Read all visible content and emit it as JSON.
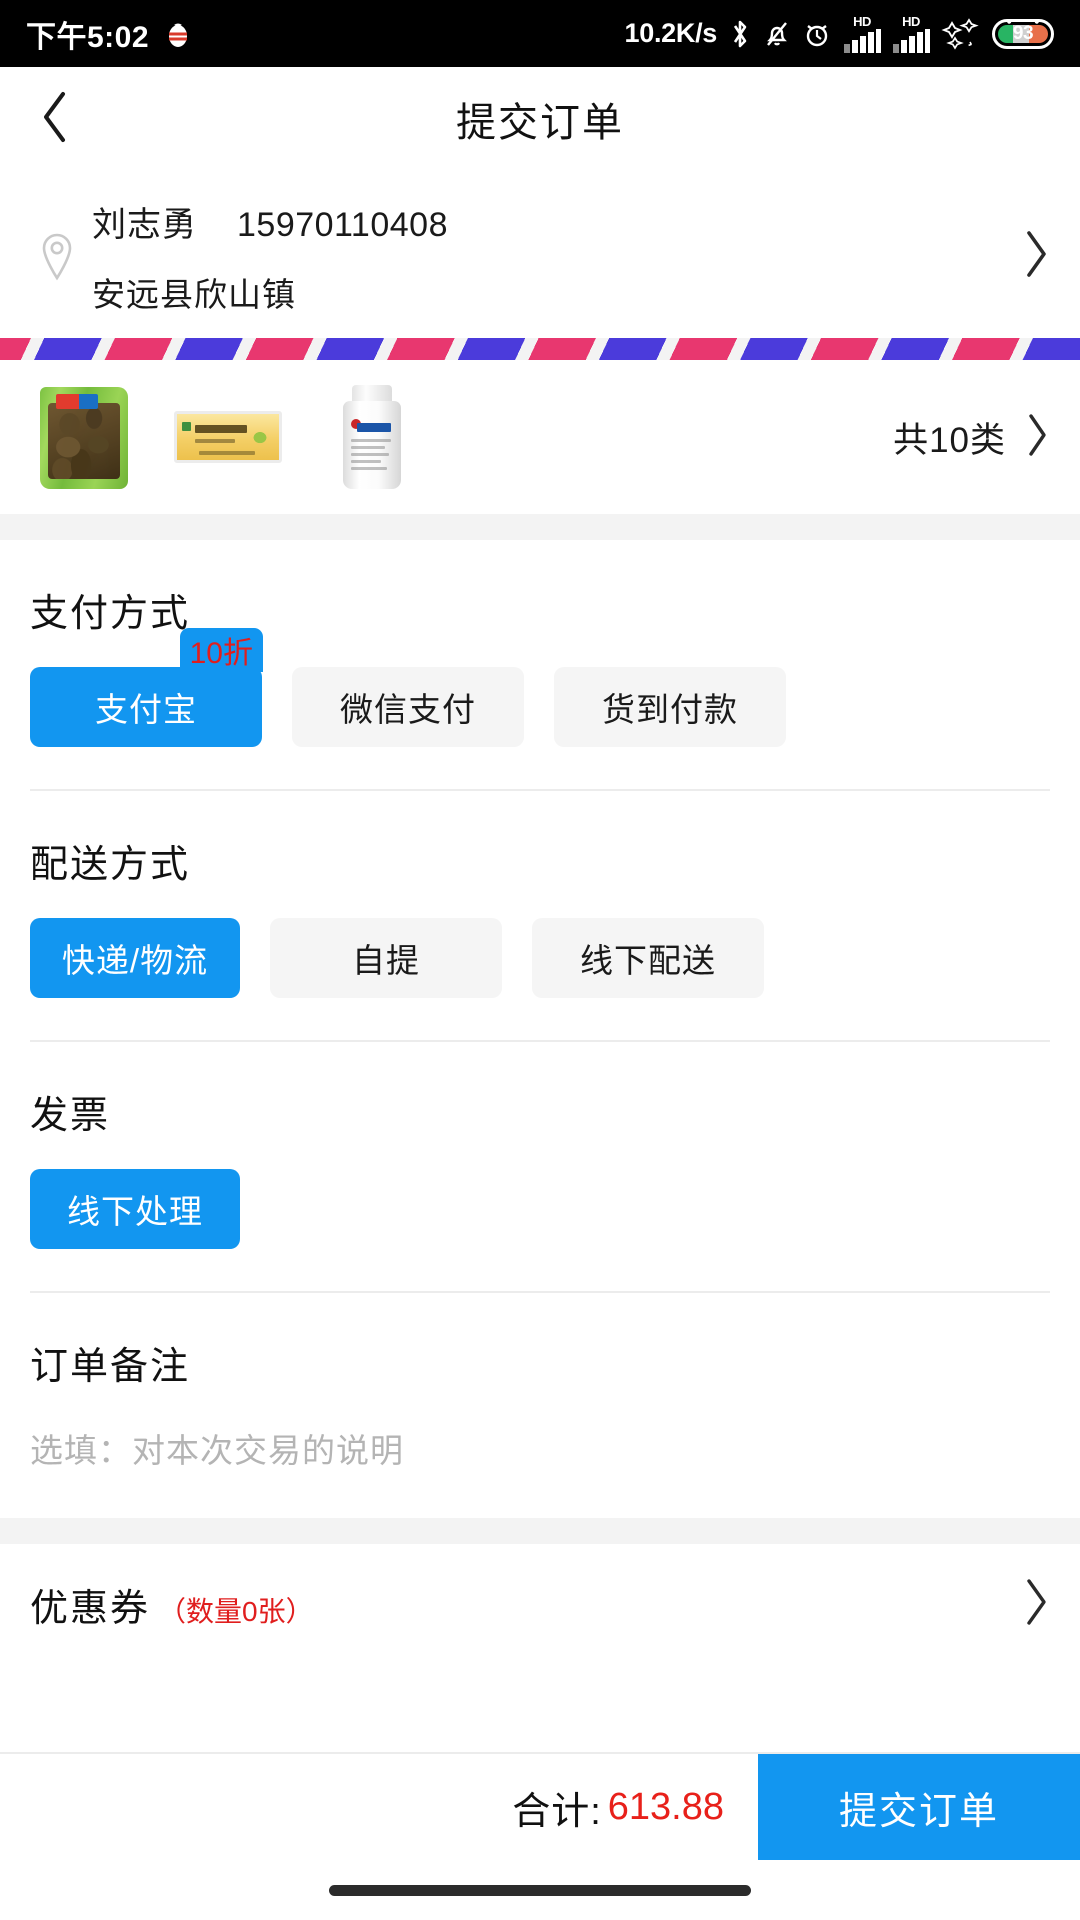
{
  "statusbar": {
    "time": "下午5:02",
    "netspeed": "10.2K/s",
    "battery_percent": "93",
    "icons": [
      "tomato-icon",
      "bluetooth-icon",
      "bell-muted-icon",
      "alarm-clock-icon",
      "hd-signal-icon",
      "hd-signal-icon",
      "sparkle-icon",
      "battery-icon"
    ],
    "hd_label_1": "HD",
    "hd_label_2": "HD"
  },
  "navbar": {
    "back_icon": "chevron-left-icon",
    "title": "提交订单"
  },
  "address": {
    "pin_icon": "location-pin-icon",
    "name": "刘志勇",
    "phone": "15970110408",
    "detail": "安远县欣山镇",
    "chevron_icon": "chevron-right-icon"
  },
  "products": {
    "thumbnails": [
      "dried-herb-bag-thumbnail",
      "yellow-medicine-box-thumbnail",
      "white-pill-bottle-thumbnail"
    ],
    "count_label": "共10类",
    "chevron_icon": "chevron-right-icon"
  },
  "payment": {
    "title": "支付方式",
    "options": [
      {
        "label": "支付宝",
        "selected": true,
        "badge": "10折"
      },
      {
        "label": "微信支付",
        "selected": false,
        "badge": ""
      },
      {
        "label": "货到付款",
        "selected": false,
        "badge": ""
      }
    ]
  },
  "delivery": {
    "title": "配送方式",
    "options": [
      {
        "label": "快递/物流",
        "selected": true
      },
      {
        "label": "自提",
        "selected": false
      },
      {
        "label": "线下配送",
        "selected": false
      }
    ]
  },
  "invoice": {
    "title": "发票",
    "options": [
      {
        "label": "线下处理",
        "selected": true
      }
    ]
  },
  "remark": {
    "title": "订单备注",
    "placeholder": "选填：对本次交易的说明",
    "value": ""
  },
  "coupon": {
    "label": "优惠券",
    "count_text": "（数量0张）",
    "chevron_icon": "chevron-right-icon"
  },
  "bottombar": {
    "total_label": "合计:",
    "total_amount": "613.88",
    "submit_label": "提交订单"
  },
  "colors": {
    "accent_blue": "#1296f0",
    "danger_red": "#e8201a",
    "badge_red": "#e01e1e",
    "chip_bg": "#f5f5f5",
    "page_bg": "#f3f3f3",
    "ribbon_blue": "#4b3bdb",
    "ribbon_pink": "#e8376f"
  }
}
